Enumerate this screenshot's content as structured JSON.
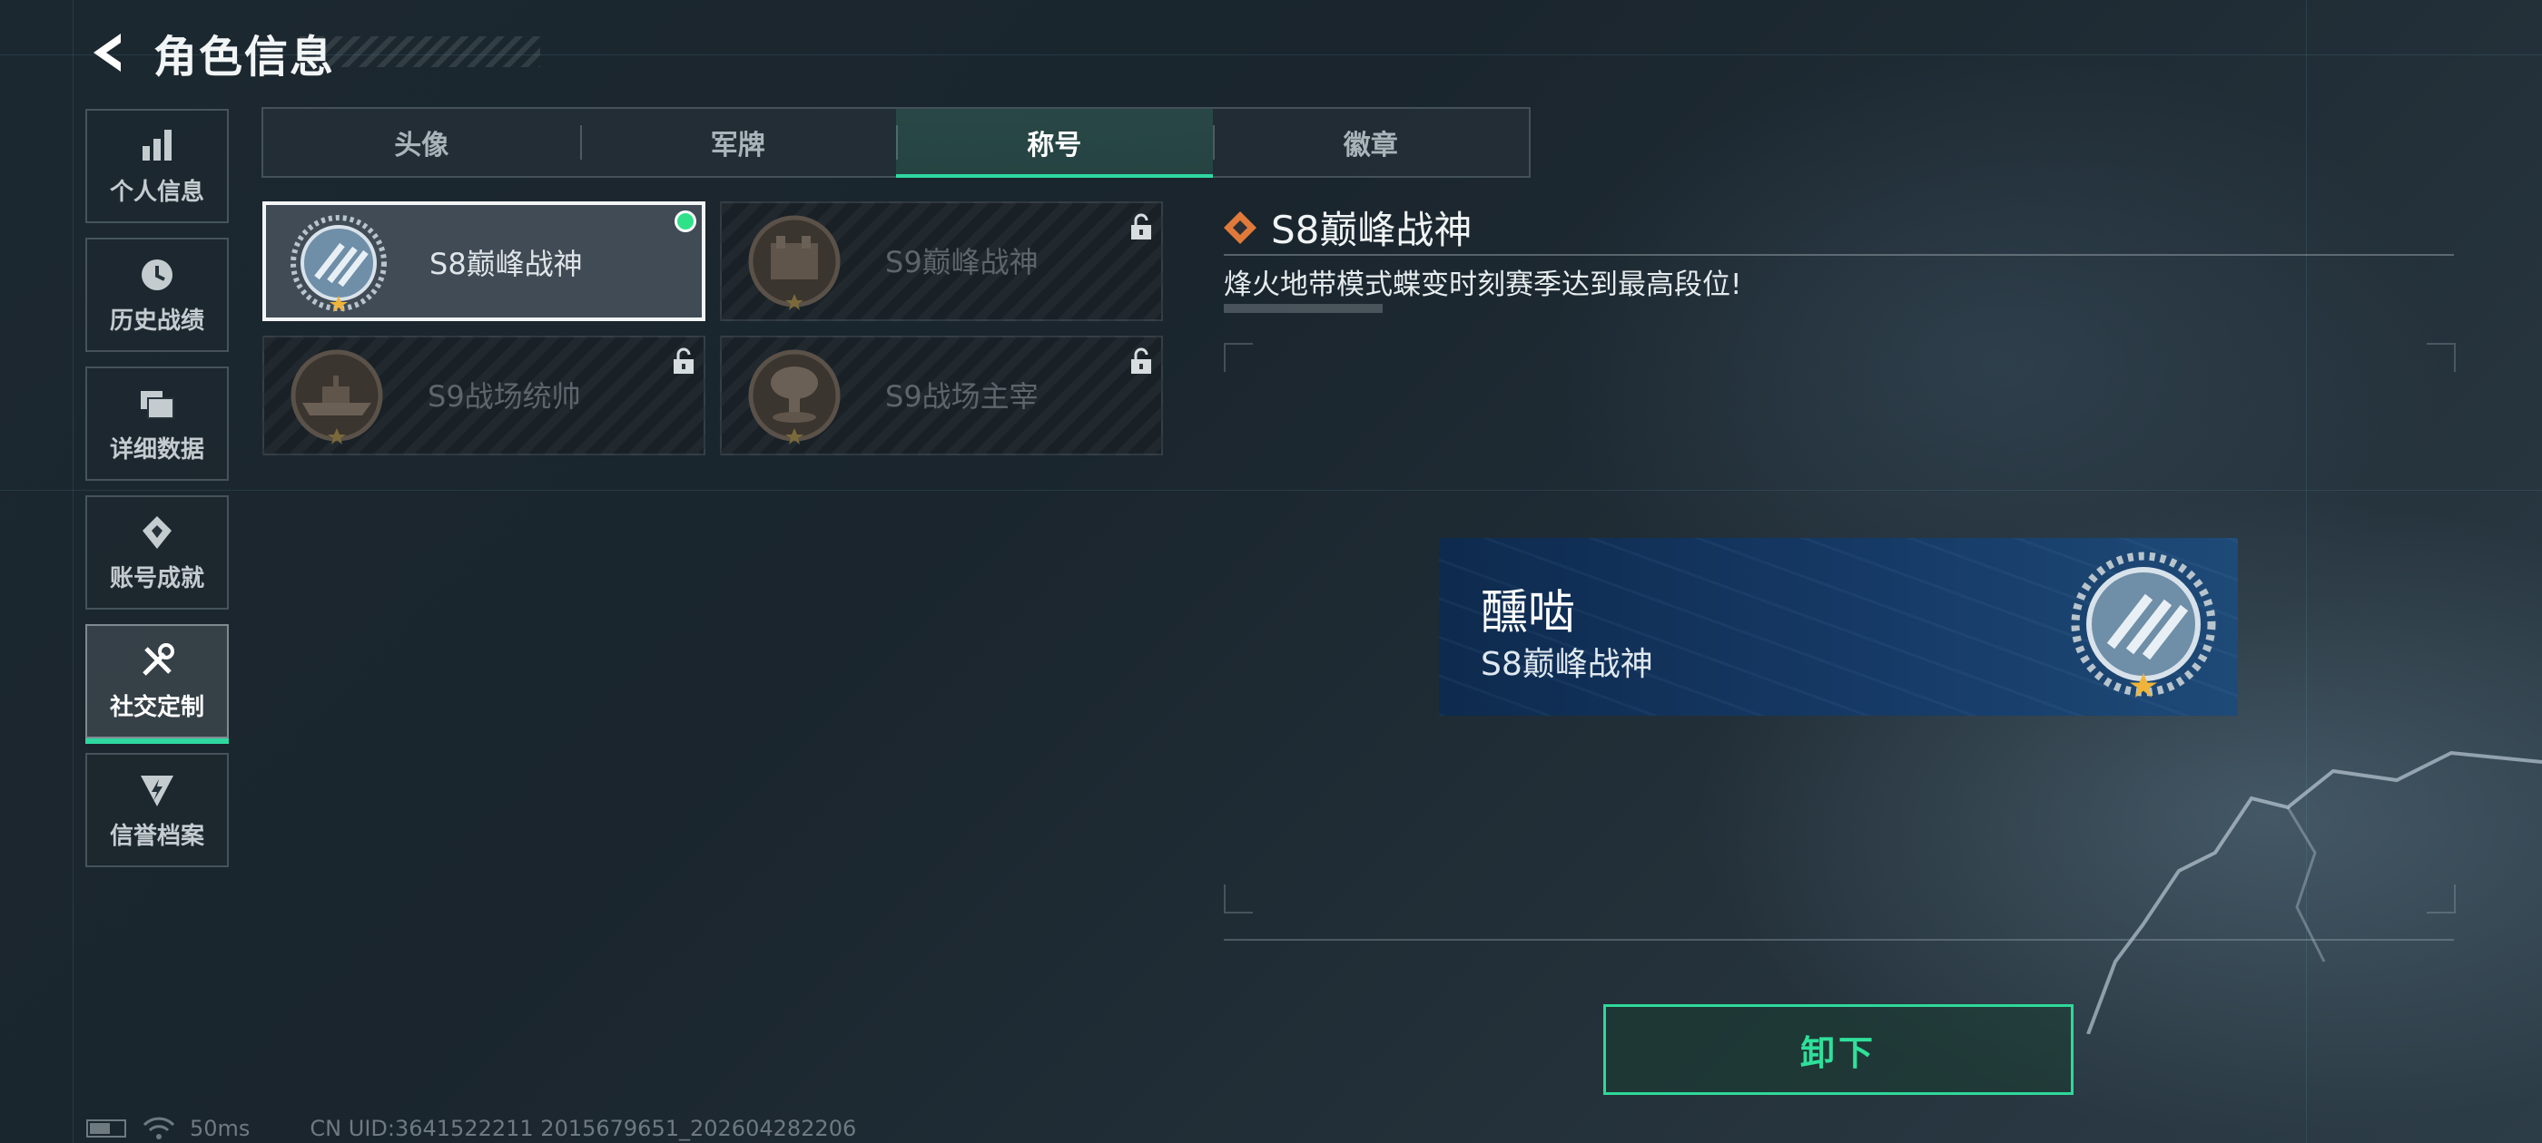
{
  "header": {
    "title": "角色信息",
    "back_icon": "back-arrow-icon"
  },
  "sidebar": {
    "items": [
      {
        "label": "个人信息",
        "icon": "bar-chart-icon",
        "active": false
      },
      {
        "label": "历史战绩",
        "icon": "history-clock-icon",
        "active": false
      },
      {
        "label": "详细数据",
        "icon": "folders-icon",
        "active": false
      },
      {
        "label": "账号成就",
        "icon": "medal-icon",
        "active": false
      },
      {
        "label": "社交定制",
        "icon": "tools-icon",
        "active": true
      },
      {
        "label": "信誉档案",
        "icon": "shield-bolt-icon",
        "active": false
      }
    ]
  },
  "tabs": [
    {
      "label": "头像",
      "active": false
    },
    {
      "label": "军牌",
      "active": false
    },
    {
      "label": "称号",
      "active": true
    },
    {
      "label": "徽章",
      "active": false
    }
  ],
  "titles": [
    {
      "name": "S8巅峰战神",
      "emblem": "slash-medal-emblem",
      "locked": false,
      "selected": true,
      "equipped": true
    },
    {
      "name": "S9巅峰战神",
      "emblem": "fortress-emblem",
      "locked": true,
      "selected": false,
      "equipped": false
    },
    {
      "name": "S9战场统帅",
      "emblem": "warship-emblem",
      "locked": true,
      "selected": false,
      "equipped": false
    },
    {
      "name": "S9战场主宰",
      "emblem": "mushroom-cloud-emblem",
      "locked": true,
      "selected": false,
      "equipped": false
    }
  ],
  "detail": {
    "title": "S8巅峰战神",
    "description": "烽火地带模式蝶变时刻赛季达到最高段位!",
    "icon": "diamond-badge-icon"
  },
  "preview": {
    "player_name": "醺啮",
    "title": "S8巅峰战神"
  },
  "actions": {
    "unequip_label": "卸下"
  },
  "status": {
    "ping": "50ms",
    "uid": "CN UID:3641522211 2015679651_202604282206"
  },
  "colors": {
    "accent": "#2fd8a0",
    "equipped_dot": "#2fe28a",
    "title_icon": "#e07a3a"
  }
}
